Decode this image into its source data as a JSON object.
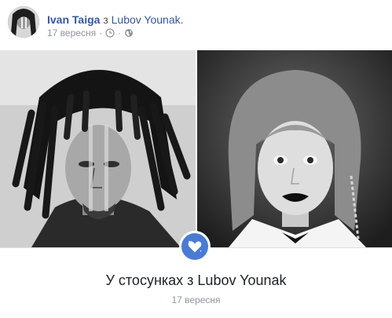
{
  "post": {
    "author": "Ivan Taiga",
    "with_word": "з",
    "tagged_user": "Lubov Younak.",
    "date": "17 вересня",
    "separator": "·",
    "icons": [
      "clock-icon",
      "globe-icon"
    ]
  },
  "photos": [
    {
      "subject": "man-with-dreadlocks"
    },
    {
      "subject": "woman-with-dark-lips"
    }
  ],
  "life_event": {
    "icon": "heart-icon",
    "title": "У стосунках з Lubov Younak",
    "date": "17 вересня",
    "badge_color": "#4a7bd3"
  },
  "colors": {
    "link": "#365899",
    "meta": "#90949c",
    "text": "#1d2129"
  }
}
